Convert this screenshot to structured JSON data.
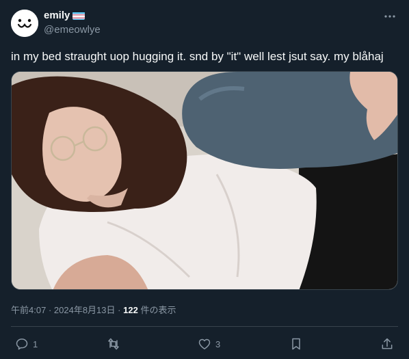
{
  "author": {
    "display_name": "emily",
    "handle": "@emeowlye",
    "avatar_icon": "smiley-face-avatar",
    "badge_icon": "transgender-flag-icon",
    "flag_colors": [
      "#5BCEFA",
      "#F5A9B8",
      "#FFFFFF",
      "#F5A9B8",
      "#5BCEFA"
    ]
  },
  "tweet": {
    "text": "in my bed straught uop hugging it. snd by \"it\" well lest jsut say. my blåhaj"
  },
  "meta": {
    "time": "午前4:07",
    "separator": "·",
    "date": "2024年8月13日",
    "views_count": "122",
    "views_label": "件の表示"
  },
  "actions": {
    "reply_count": "1",
    "retweet_count": "",
    "like_count": "3",
    "icons": [
      "reply-icon",
      "retweet-icon",
      "like-icon",
      "bookmark-icon",
      "share-icon"
    ]
  },
  "theme": {
    "background": "#15202b",
    "text": "#f7f9f9",
    "secondary": "#8b98a5",
    "border": "#38444d"
  }
}
